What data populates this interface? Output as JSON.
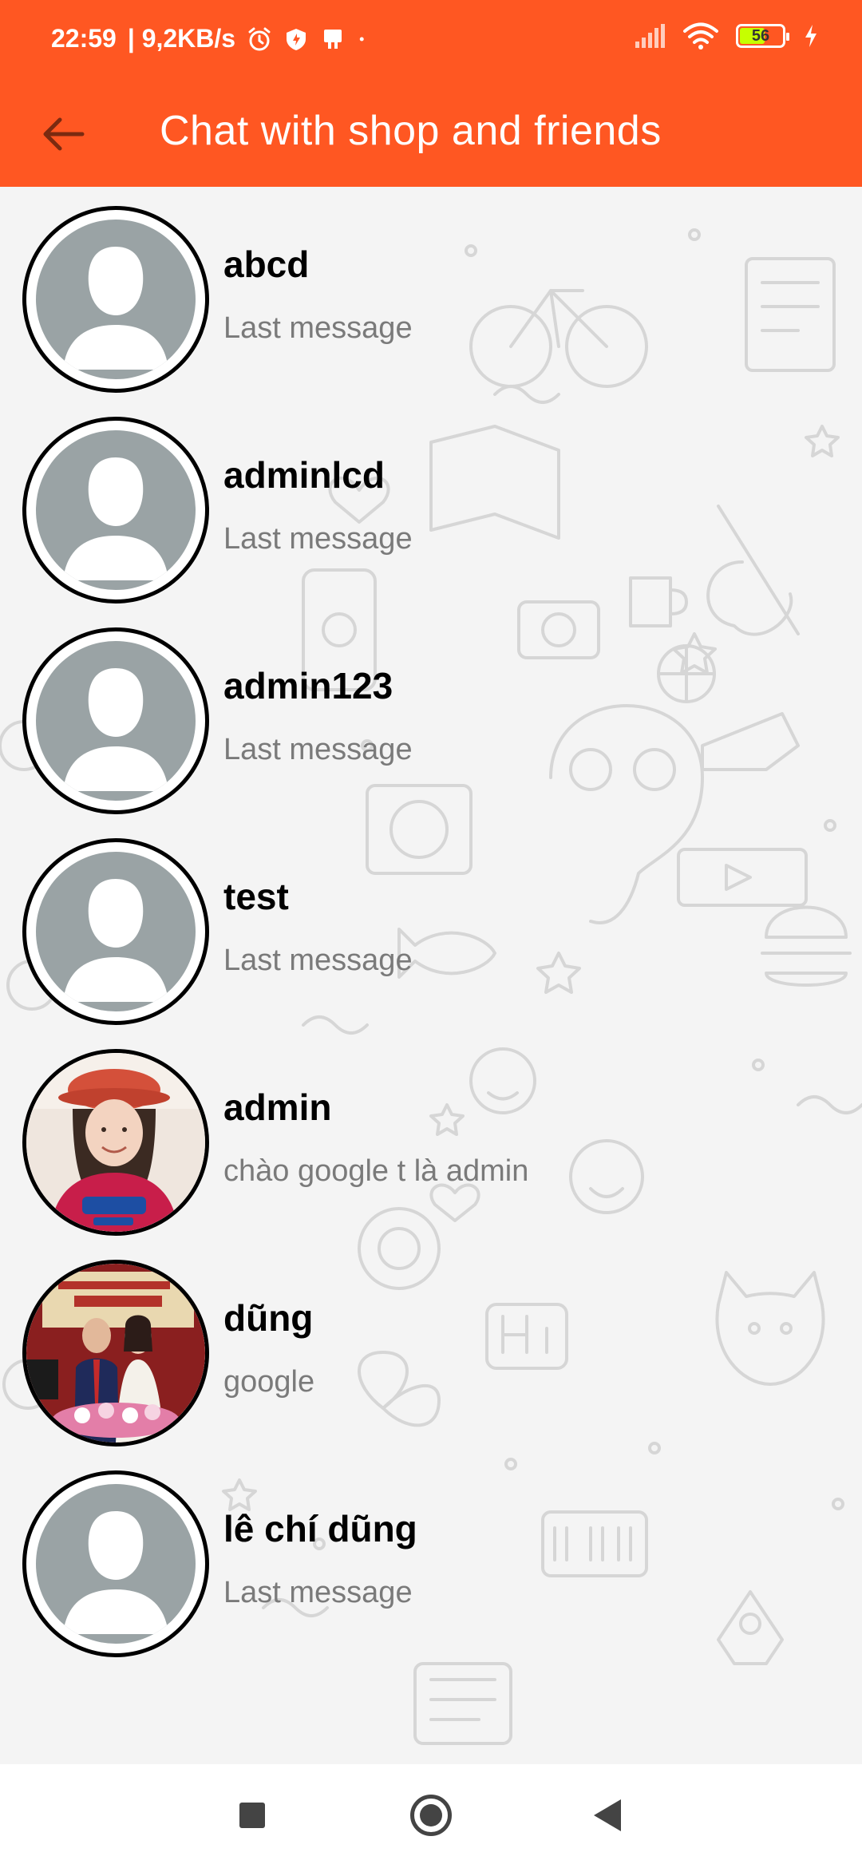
{
  "status_bar": {
    "time": "22:59",
    "speed": "| 9,2KB/s",
    "battery_level": "56",
    "icons": [
      "alarm-icon",
      "shield-icon",
      "notification-icon",
      "dot-icon",
      "signal-icon",
      "wifi-icon",
      "battery-icon",
      "charging-icon"
    ]
  },
  "header": {
    "title": "Chat with shop and friends",
    "back_icon": "arrow-left-icon"
  },
  "chats": [
    {
      "name": "abcd",
      "last_message": "Last message",
      "avatar": "default"
    },
    {
      "name": "adminlcd",
      "last_message": "Last message",
      "avatar": "default"
    },
    {
      "name": "admin123",
      "last_message": "Last message",
      "avatar": "default"
    },
    {
      "name": "test",
      "last_message": "Last message",
      "avatar": "default"
    },
    {
      "name": "admin",
      "last_message": "chào google t là admin",
      "avatar": "photo"
    },
    {
      "name": "dũng",
      "last_message": "google",
      "avatar": "photo"
    },
    {
      "name": "lê chí dũng",
      "last_message": "Last message",
      "avatar": "default"
    }
  ],
  "nav_bar": {
    "icons": [
      "recents-icon",
      "home-icon",
      "back-icon"
    ]
  },
  "colors": {
    "primary": "#ff5722",
    "name_text": "#000000",
    "secondary_text": "#7a7a7a",
    "default_avatar": "#9aa3a5"
  }
}
